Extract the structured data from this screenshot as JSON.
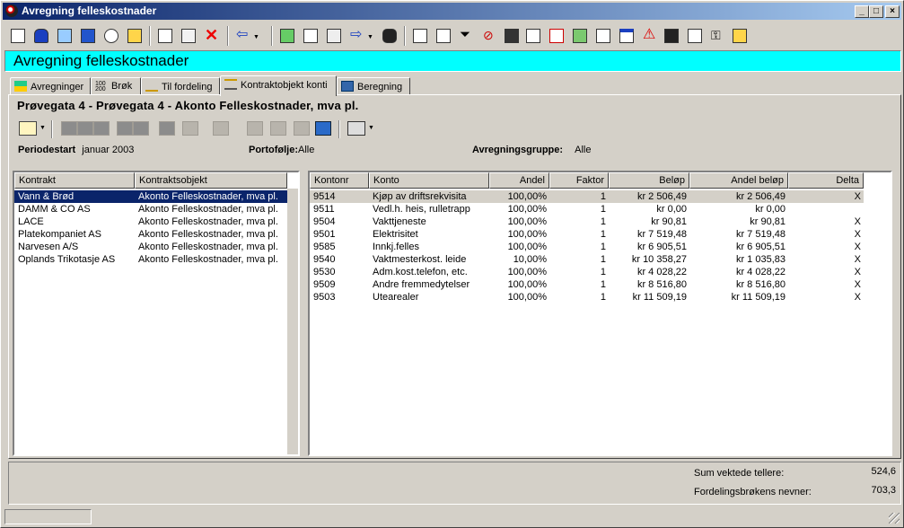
{
  "window": {
    "title": "Avregning felleskostnader",
    "minimize": "_",
    "maximize": "□",
    "close": "×"
  },
  "toolbar_icons": [
    "report-icon",
    "user-icon",
    "network-icon",
    "document-icon",
    "link-icon",
    "export-icon",
    "edit-doc-icon",
    "edit-icon",
    "delete-icon",
    "back-arrow-icon",
    "calculator-icon",
    "form-icon",
    "card-icon",
    "forward-arrow-icon",
    "binoculars-icon",
    "filter-doc-icon",
    "filter-list-icon",
    "filter-icon",
    "clear-filter-icon",
    "books-icon",
    "chart-icon",
    "giro-icon",
    "image-icon",
    "house-icon",
    "window-icon",
    "warning-icon",
    "save-icon",
    "notepad-icon",
    "key-icon",
    "settings-icon"
  ],
  "banner": {
    "text": "Avregning felleskostnader"
  },
  "tabs": [
    {
      "label": "Avregninger",
      "icon": "building-icon"
    },
    {
      "label": "Brøk",
      "icon": "fraction-icon"
    },
    {
      "label": "Til fordeling",
      "icon": "distribution-icon"
    },
    {
      "label": "Kontraktobjekt konti",
      "icon": "scale-icon",
      "active": true
    },
    {
      "label": "Beregning",
      "icon": "calculator-icon"
    }
  ],
  "heading": "Prøvegata 4 - Prøvegata 4 - Akonto Felleskostnader, mva pl.",
  "info": {
    "periodestart_label": "Periodestart",
    "periodestart_value": "januar 2003",
    "portefolje_label": "Portofølje:",
    "portefolje_value": "Alle",
    "gruppe_label": "Avregningsgruppe:",
    "gruppe_value": "Alle"
  },
  "left_table": {
    "columns": [
      "Kontrakt",
      "Kontraktsobjekt"
    ],
    "rows": [
      [
        "Vann & Brød",
        "Akonto Felleskostnader, mva pl."
      ],
      [
        "DAMM & CO AS",
        "Akonto Felleskostnader, mva pl."
      ],
      [
        "LACE",
        "Akonto Felleskostnader, mva pl."
      ],
      [
        "Platekompaniet AS",
        "Akonto Felleskostnader, mva pl."
      ],
      [
        "Narvesen A/S",
        "Akonto Felleskostnader, mva pl."
      ],
      [
        "Oplands Trikotasje AS",
        "Akonto Felleskostnader, mva pl."
      ]
    ],
    "selected_row": 0
  },
  "right_table": {
    "columns": [
      "Kontonr",
      "Konto",
      "Andel",
      "Faktor",
      "Beløp",
      "Andel beløp",
      "Delta"
    ],
    "rows": [
      [
        "9514",
        "Kjøp av driftsrekvisita",
        "100,00%",
        "1",
        "kr 2 506,49",
        "kr 2 506,49",
        "X"
      ],
      [
        "9511",
        "Vedl.h. heis, rulletrapp",
        "100,00%",
        "1",
        "kr 0,00",
        "kr 0,00",
        ""
      ],
      [
        "9504",
        "Vakttjeneste",
        "100,00%",
        "1",
        "kr 90,81",
        "kr 90,81",
        "X"
      ],
      [
        "9501",
        "Elektrisitet",
        "100,00%",
        "1",
        "kr 7 519,48",
        "kr 7 519,48",
        "X"
      ],
      [
        "9585",
        "Innkj.felles",
        "100,00%",
        "1",
        "kr 6 905,51",
        "kr 6 905,51",
        "X"
      ],
      [
        "9540",
        "Vaktmesterkost. leide",
        "10,00%",
        "1",
        "kr 10 358,27",
        "kr 1 035,83",
        "X"
      ],
      [
        "9530",
        "Adm.kost.telefon, etc.",
        "100,00%",
        "1",
        "kr 4 028,22",
        "kr 4 028,22",
        "X"
      ],
      [
        "9509",
        "Andre fremmedytelser",
        "100,00%",
        "1",
        "kr 8 516,80",
        "kr 8 516,80",
        "X"
      ],
      [
        "9503",
        "Utearealer",
        "100,00%",
        "1",
        "kr 11 509,19",
        "kr 11 509,19",
        "X"
      ]
    ],
    "selected_row": 0
  },
  "summary": {
    "sum_label": "Sum vektede tellere:",
    "sum_value": "524,6",
    "nevner_label": "Fordelingsbrøkens nevner:",
    "nevner_value": "703,3"
  },
  "colors": {
    "banner": "#00ffff",
    "title_start": "#0a246a",
    "title_end": "#a6caf0",
    "selection": "#0a246a",
    "face": "#d4d0c8"
  }
}
